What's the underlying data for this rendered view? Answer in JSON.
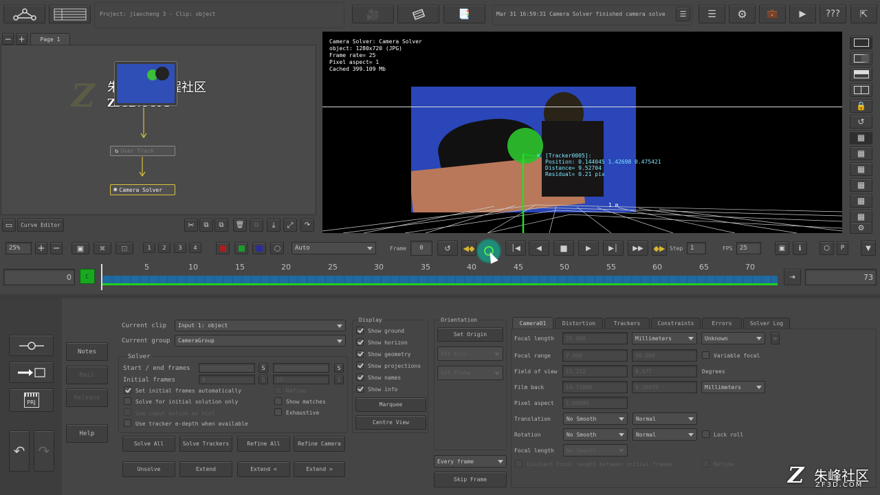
{
  "topbar": {
    "project": "Project: jiaocheng 3 - Clip: object",
    "status": "Mar 31 16:59:31 Camera Solver finished camera solve",
    "help_label": "???"
  },
  "node_editor": {
    "page_tab": "Page 1",
    "nodes": [
      "User Track",
      "Camera Solver"
    ],
    "curve_editor": "Curve Editor"
  },
  "watermark": {
    "cn_title": "朱峰视频教程社区",
    "site": "ZF3D.COM",
    "corner_cn": "朱峰社区",
    "corner_site": "ZF3D.COM"
  },
  "viewer": {
    "info": [
      "Camera Solver: Camera Solver",
      "object: 1280x720 (JPG)",
      "Frame rate= 25",
      "Pixel aspect= 1",
      "Cached 399.109 Mb"
    ],
    "tracker": [
      "[Tracker0005]:",
      "Position: 0.144045 1.42698 0.475421",
      "Distance= 9.52704",
      "Residual= 0.21 pix"
    ],
    "scale_label": "1 m"
  },
  "controls": {
    "zoom": "25%",
    "views": [
      "1",
      "2",
      "3",
      "4"
    ],
    "mode": "Auto",
    "frame_label": "Frame",
    "frame_value": "0",
    "step_label": "Step",
    "step_value": "1",
    "fps_label": "FPS",
    "fps_value": "25",
    "p_label": "P"
  },
  "timeline": {
    "start": "0",
    "end": "73",
    "c_label": "C",
    "ticks": [
      "5",
      "10",
      "15",
      "20",
      "25",
      "30",
      "35",
      "40",
      "45",
      "50",
      "55",
      "60",
      "65",
      "70"
    ]
  },
  "left_buttons": {
    "notes": "Notes",
    "mail": "Mail",
    "release": "Release",
    "help": "Help",
    "prj": "PRJ"
  },
  "solver": {
    "current_clip_label": "Current clip",
    "current_clip": "Input 1: object",
    "current_group_label": "Current group",
    "current_group": "CameraGroup",
    "section": "Solver",
    "start_end_label": "Start / end frames",
    "initial_frames_label": "Initial frames",
    "initial_a": "0",
    "initial_b": "15",
    "s_label": "S",
    "set_initial": "Set initial frames automatically",
    "refine": "Refine",
    "solve_initial": "Solve for initial solution only",
    "show_matches": "Show matches",
    "use_input": "Use input motion as hint",
    "exhaustive": "Exhaustive",
    "use_tracker": "Use tracker e-depth when available",
    "buttons": [
      "Solve All",
      "Solve Trackers",
      "Refine All",
      "Refine Camera",
      "Unsolve",
      "Extend",
      "Extend <",
      "Extend >"
    ]
  },
  "display": {
    "title": "Display",
    "items": [
      "Show ground",
      "Show horizon",
      "Show geometry",
      "Show projections",
      "Show names",
      "Show info"
    ],
    "marquee": "Marquee",
    "centre_view": "Centre View"
  },
  "orientation": {
    "title": "Orientation",
    "set_origin": "Set Origin",
    "set_axis": "Set axis",
    "set_plane": "Set Plane",
    "every_frame": "Every frame",
    "skip_frame": "Skip Frame"
  },
  "camera": {
    "tabs": [
      "Camera01",
      "Distortion",
      "Trackers",
      "Constraints",
      "Errors",
      "Solver Log"
    ],
    "focal_length_label": "Focal length",
    "focal_length": "35.000",
    "units": "Millimeters",
    "unknown": "Unknown",
    "focal_range_label": "Focal range",
    "range_a": "7.000",
    "range_b": "50.000",
    "variable_focal": "Variable focal",
    "fov_label": "Field of view",
    "fov_a": "15.212",
    "fov_b": "8.477",
    "degrees": "Degrees",
    "film_back_label": "Film back",
    "film_a": "14.13880",
    "film_b": "9.30070",
    "film_units": "Millimeters",
    "pixel_aspect_label": "Pixel aspect",
    "pixel_aspect": "1.00000",
    "translation_label": "Translation",
    "rotation_label": "Rotation",
    "no_smooth": "No Smooth",
    "normal": "Normal",
    "lock_roll": "Lock roll",
    "focal_length2_label": "Focal length",
    "constant_focal": "Constant focal length between initial frames",
    "refine_chk": "Refine"
  }
}
